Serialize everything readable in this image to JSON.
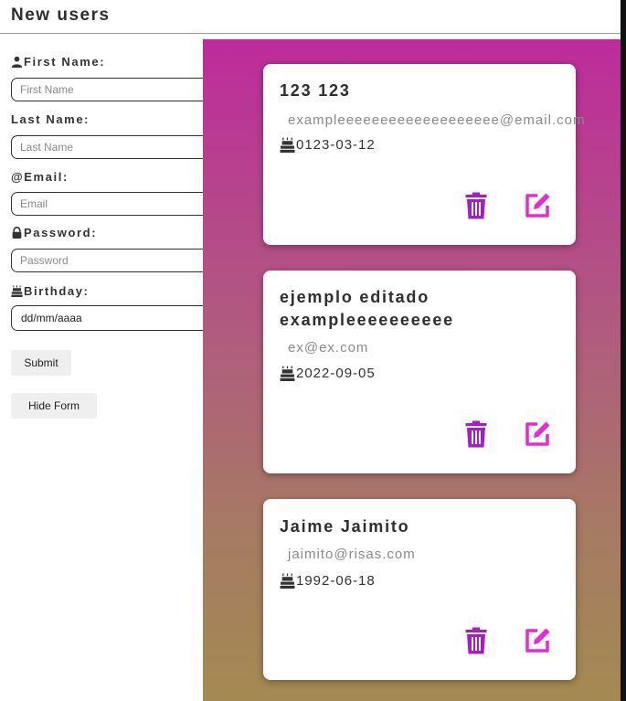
{
  "header": {
    "title": "New users"
  },
  "form": {
    "first_name_label": "First Name:",
    "first_name_placeholder": "First Name",
    "last_name_label": "Last Name:",
    "last_name_placeholder": "Last Name",
    "email_label": "@Email:",
    "email_placeholder": "Email",
    "password_label": "Password:",
    "password_placeholder": "Password",
    "birthday_label": "Birthday:",
    "birthday_value": "dd/mm/aaaa",
    "submit_label": "Submit",
    "hide_form_label": "Hide Form"
  },
  "users": [
    {
      "name": "123 123",
      "email": "exampleeeeeeeeeeeeeeeeeee@email.com",
      "birthday": "0123-03-12"
    },
    {
      "name": "ejemplo editado exampleeeeeeeeee",
      "email": "ex@ex.com",
      "birthday": "2022-09-05"
    },
    {
      "name": "Jaime Jaimito",
      "email": "jaimito@risas.com",
      "birthday": "1992-06-18"
    }
  ],
  "icons": {
    "person": "person-icon",
    "lock": "lock-icon",
    "cake": "cake-icon",
    "calendar": "calendar-icon",
    "delete": "trash-icon",
    "edit": "edit-icon"
  },
  "colors": {
    "delete_icon": "#a51ec1",
    "edit_icon": "#e62bd2",
    "gradient_top": "#bd2b9c",
    "gradient_bottom": "#a38a52"
  }
}
